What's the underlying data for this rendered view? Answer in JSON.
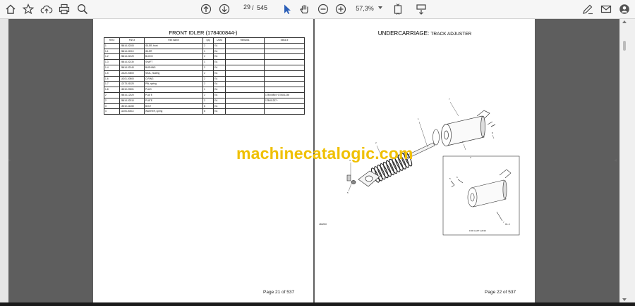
{
  "toolbar": {
    "current_page": "29",
    "page_separator": "/",
    "total_pages": "545",
    "zoom": "57,3%"
  },
  "left_page": {
    "title": "FRONT IDLER (178400844-)",
    "columns": [
      "Ref #",
      "Part #",
      "Part Name",
      "Qty",
      "UOM",
      "Remarks",
      "Serial #"
    ],
    "rows": [
      [
        "1",
        "26614-02100",
        "IDLER, front",
        "2",
        "EA",
        "",
        ""
      ],
      [
        "1-1",
        "26614-02110",
        "IDLER",
        "1",
        "EA",
        "",
        ""
      ],
      [
        "1-2",
        "26614-02120",
        "BLOCK",
        "2",
        "EA",
        "",
        ""
      ],
      [
        "1-3",
        "26614-02130",
        "SHAFT",
        "1",
        "EA",
        "",
        ""
      ],
      [
        "1-4",
        "26614-02140",
        "BUSHING",
        "2",
        "EA",
        "",
        ""
      ],
      [
        "1-5",
        "14320-00600",
        "SEAL, floating",
        "2",
        "EA",
        "",
        ""
      ],
      [
        "1-6",
        "14201-00500",
        "O-RING",
        "2",
        "EA",
        "",
        ""
      ],
      [
        "1-7",
        "12173-01020",
        "PIN, spring",
        "2",
        "EA",
        "",
        ""
      ],
      [
        "1-8",
        "16010-20001",
        "PLUG",
        "1",
        "EA",
        "",
        ""
      ],
      [
        "2",
        "26614-12020",
        "PLATE",
        "2",
        "EA",
        "",
        "178400844~178401238"
      ],
      [
        "2",
        "26614-02010",
        "PLATE",
        "2",
        "EA",
        "",
        "178401237~"
      ],
      [
        "3",
        "15010-41450",
        "BOLT",
        "8",
        "EA",
        "",
        ""
      ],
      [
        "4",
        "11405-20614",
        "WASHER, spring",
        "8",
        "EA",
        "",
        ""
      ]
    ],
    "footer": "Page 21 of 537"
  },
  "right_page": {
    "title_main": "UNDERCARRIAGE:",
    "title_sub": "TRACK ADJUSTER",
    "callouts": [
      "1",
      "2",
      "3",
      "4",
      "5",
      "6",
      "7",
      "8",
      "7",
      "6",
      "5"
    ],
    "inset_label": "FOR LEFT HAND",
    "figure_code": "LB4090",
    "figure_code_right": "HL-1",
    "footer": "Page 22 of 537"
  },
  "watermark": "machinecatalogic.com",
  "colors": {
    "watermark": "#f0c000",
    "viewport_bg": "#5e5e5e",
    "toolbar_bg": "#f6f6f6"
  }
}
